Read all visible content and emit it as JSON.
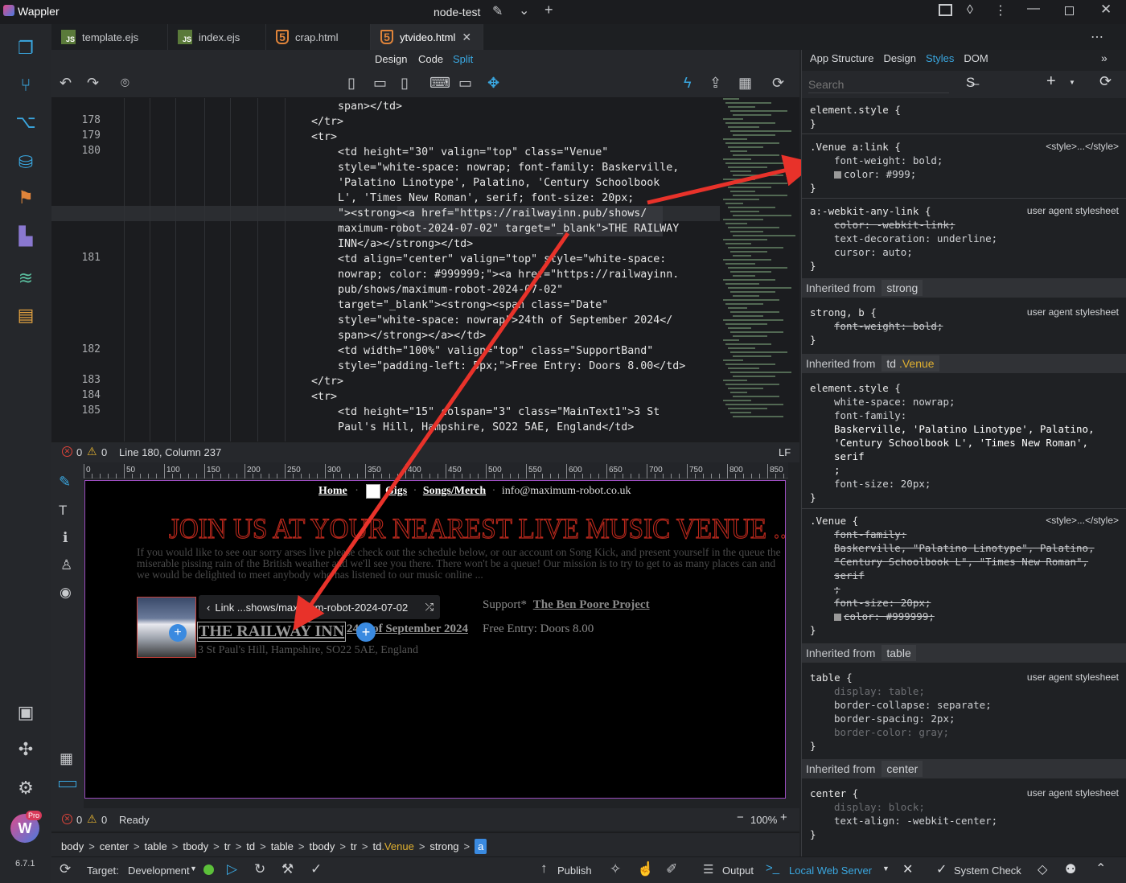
{
  "app": {
    "name": "Wappler",
    "project": "node-test",
    "version": "6.7.1",
    "pro_badge": "Pro"
  },
  "tabs": [
    {
      "label": "template.ejs",
      "icon": "js-icon"
    },
    {
      "label": "index.ejs",
      "icon": "js-icon"
    },
    {
      "label": "crap.html",
      "icon": "html5-icon"
    },
    {
      "label": "ytvideo.html",
      "icon": "html5-icon",
      "active": true
    }
  ],
  "view_modes": {
    "design": "Design",
    "code": "Code",
    "split": "Split"
  },
  "code": {
    "lines": [
      {
        "n": "",
        "t": "span></td>"
      },
      {
        "n": "178",
        "t": "</tr>"
      },
      {
        "n": "179",
        "t": "<tr>"
      },
      {
        "n": "180",
        "t": "<td height=\"30\" valign=\"top\" class=\"Venue\""
      },
      {
        "n": "",
        "t": "style=\"white-space: nowrap; font-family: Baskerville,"
      },
      {
        "n": "",
        "t": "'Palatino Linotype', Palatino, 'Century Schoolbook"
      },
      {
        "n": "",
        "t": "L', 'Times New Roman', serif; font-size: 20px;"
      },
      {
        "n": "",
        "t": "\"><strong><a href=\"https://railwayinn.pub/shows/"
      },
      {
        "n": "",
        "t": "maximum-robot-2024-07-02\" target=\"_blank\">THE RAILWAY"
      },
      {
        "n": "",
        "t": "INN</a></strong></td>"
      },
      {
        "n": "181",
        "t": "<td align=\"center\" valign=\"top\" style=\"white-space:"
      },
      {
        "n": "",
        "t": "nowrap; color: #999999;\"><a href=\"https://railwayinn."
      },
      {
        "n": "",
        "t": "pub/shows/maximum-robot-2024-07-02\""
      },
      {
        "n": "",
        "t": "target=\"_blank\"><strong><span class=\"Date\""
      },
      {
        "n": "",
        "t": "style=\"white-space: nowrap\">24th of September 2024</"
      },
      {
        "n": "",
        "t": "span></strong></a></td>"
      },
      {
        "n": "182",
        "t": "<td width=\"100%\" valign=\"top\" class=\"SupportBand\""
      },
      {
        "n": "",
        "t": "style=\"padding-left: 5px;\">Free Entry: Doors 8.00</td>"
      },
      {
        "n": "183",
        "t": "</tr>"
      },
      {
        "n": "184",
        "t": "<tr>"
      },
      {
        "n": "185",
        "t": "<td height=\"15\" colspan=\"3\" class=\"MainText1\">3 St"
      },
      {
        "n": "",
        "t": "Paul's Hill, Hampshire, SO22 5AE, England</td>"
      }
    ]
  },
  "status_top": {
    "errors": "0",
    "warnings": "0",
    "position": "Line 180, Column 237",
    "eol": "LF"
  },
  "ruler": [
    "0",
    "50",
    "100",
    "150",
    "200",
    "250",
    "300",
    "350",
    "400",
    "450",
    "500",
    "550",
    "600",
    "650",
    "700",
    "750",
    "800",
    "850"
  ],
  "preview": {
    "nav": {
      "home": "Home",
      "gigs": "Gigs",
      "songs": "Songs/Merch",
      "email": "info@maximum-robot.co.uk"
    },
    "heading": "JOIN US AT YOUR NEAREST LIVE MUSIC VENUE ...",
    "intro": "If you would like to see our sorry arses live please check out the schedule below, or our account on Song Kick, and present yourself in the queue the miserable pissing rain of the British weather and we'll see you there. There won't be a queue! Our mission is to try to get to as many places can and we would be delighted to meet anybody who has listened to our music online ...",
    "link_tooltip": "Link ...shows/maximum-robot-2024-07-02",
    "venue": "THE RAILWAY INN",
    "date": "24th of September 2024",
    "support_label": "Support*",
    "support_band": "The Ben Poore Project",
    "entry": "Free Entry: Doors 8.00",
    "address": "3 St Paul's Hill, Hampshire, SO22 5AE, England"
  },
  "status_bottom": {
    "errors": "0",
    "warnings": "0",
    "state": "Ready",
    "zoom": "100%"
  },
  "breadcrumb": [
    "body",
    "center",
    "table",
    "tbody",
    "tr",
    "td",
    "table",
    "tbody",
    "tr",
    "td.Venue",
    "strong",
    "a"
  ],
  "footer": {
    "target_label": "Target:",
    "target": "Development",
    "publish": "Publish",
    "output": "Output",
    "server": "Local Web Server",
    "system_check": "System Check"
  },
  "right_panel": {
    "tabs": {
      "app_structure": "App Structure",
      "design": "Design",
      "styles": "Styles",
      "dom": "DOM"
    },
    "search_placeholder": "Search",
    "rules": {
      "element_style": "element.style {",
      "close": "}",
      "venue_link_selector": ".Venue a:link {",
      "venue_link_source": "<style>...</style>",
      "venue_link_fw": "font-weight: bold;",
      "venue_link_color": "color: #999;",
      "webkit_selector": "a:-webkit-any-link {",
      "ua": "user agent stylesheet",
      "webkit_color": "color: -webkit-link;",
      "webkit_td": "text-decoration: underline;",
      "webkit_cursor": "cursor: auto;",
      "inherited_from": "Inherited from",
      "strong_tag": "strong",
      "strong_selector": "strong, b {",
      "strong_fw": "font-weight: bold;",
      "td_tag": "td",
      "td_class": ".Venue",
      "td_ws": "white-space: nowrap;",
      "td_ff": "font-family:",
      "td_ff1": "Baskerville, 'Palatino Linotype', Palatino,",
      "td_ff2": "'Century Schoolbook L', 'Times New Roman',",
      "td_ff3": "serif",
      "td_ff4": ";",
      "td_fs": "font-size: 20px;",
      "venue_selector": ".Venue {",
      "venue_source": "<style>...</style>",
      "v_ff": "font-family:",
      "v_ff1": "Baskerville, \"Palatino Linotype\", Palatino,",
      "v_ff2": "\"Century Schoolbook L\", \"Times New Roman\",",
      "v_ff3": "serif",
      "v_ff4": ";",
      "v_fs": "font-size: 20px;",
      "v_color": "color: #999999;",
      "table_tag": "table",
      "table_selector": "table {",
      "t_display": "display: table;",
      "t_bc": "border-collapse: separate;",
      "t_bs": "border-spacing: 2px;",
      "t_bcol": "border-color: gray;",
      "center_tag": "center",
      "center_selector": "center {",
      "c_display": "display: block;",
      "c_ta": "text-align: -webkit-center;"
    }
  },
  "colors": {
    "accent": "#3aa7e0",
    "heading_red": "#b8281c",
    "annotation_arrow": "#e8322a",
    "preview_border": "#9b4dbf"
  }
}
